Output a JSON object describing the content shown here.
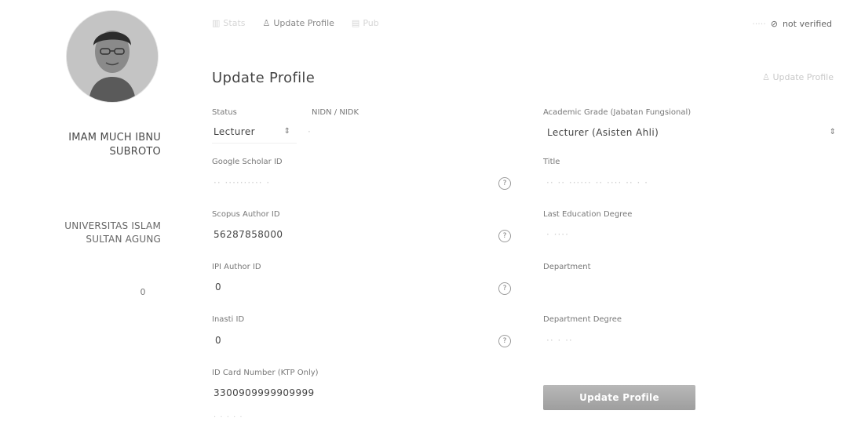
{
  "sidebar": {
    "name": "IMAM MUCH IBNU\nSUBROTO",
    "affiliation": "UNIVERSITAS ISLAM\nSULTAN AGUNG",
    "count": "0"
  },
  "nav": {
    "tab_stats": "Stats",
    "tab_update": "Update Profile",
    "tab_pub": "Pub",
    "verify_status": "not verified"
  },
  "page": {
    "title": "Update Profile",
    "top_right": "Update Profile"
  },
  "form": {
    "status_label": "Status",
    "status_value": "Lecturer",
    "nidn_label": "NIDN / NIDK",
    "gs_label": "Google Scholar ID",
    "scopus_label": "Scopus Author ID",
    "scopus_value": "56287858000",
    "ipi_label": "IPI Author ID",
    "ipi_value": "0",
    "inasti_label": "Inasti ID",
    "inasti_value": "0",
    "idcard_label": "ID Card Number (KTP Only)",
    "idcard_value": "3300909999909999",
    "grade_label": "Academic Grade (Jabatan Fungsional)",
    "grade_value": "Lecturer (Asisten Ahli)",
    "title_label": "Title",
    "lastedu_label": "Last Education Degree",
    "dept_label": "Department",
    "deptdeg_label": "Department Degree",
    "submit": "Update Profile"
  },
  "icons": {
    "help": "help-circle-icon",
    "user": "user-icon",
    "stats": "chart-icon",
    "pub": "document-icon",
    "select": "chevron-updown-icon"
  }
}
